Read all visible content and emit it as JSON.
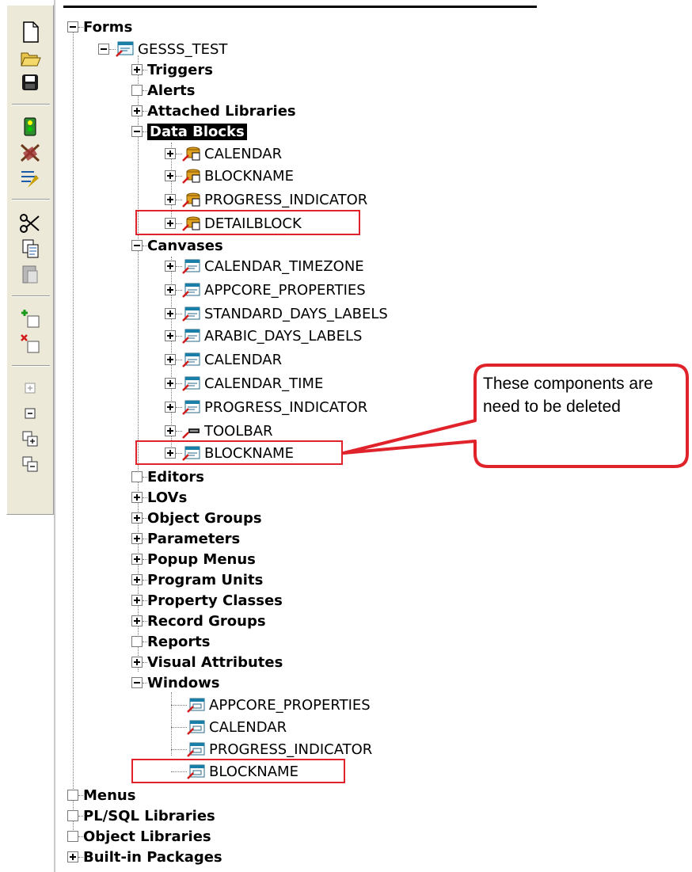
{
  "toolbar": {
    "buttons": [
      {
        "name": "new-icon"
      },
      {
        "name": "open-icon"
      },
      {
        "name": "save-icon"
      },
      {
        "name": "run-icon"
      },
      {
        "name": "debug-icon"
      },
      {
        "name": "compile-icon"
      },
      {
        "name": "cut-icon"
      },
      {
        "name": "copy-icon"
      },
      {
        "name": "paste-icon"
      },
      {
        "name": "create-icon"
      },
      {
        "name": "delete-icon"
      },
      {
        "name": "expand-icon"
      },
      {
        "name": "collapse-icon"
      },
      {
        "name": "expand-all-icon"
      },
      {
        "name": "collapse-all-icon"
      }
    ]
  },
  "tree": {
    "forms": "Forms",
    "module": "GESSS_TEST",
    "triggers": "Triggers",
    "alerts": "Alerts",
    "attached_libraries": "Attached Libraries",
    "data_blocks": "Data Blocks",
    "blocks": [
      "CALENDAR",
      "BLOCKNAME",
      "PROGRESS_INDICATOR",
      "DETAILBLOCK"
    ],
    "canvases": "Canvases",
    "canvas_items": [
      "CALENDAR_TIMEZONE",
      "APPCORE_PROPERTIES",
      "STANDARD_DAYS_LABELS",
      "ARABIC_DAYS_LABELS",
      "CALENDAR",
      "CALENDAR_TIME",
      "PROGRESS_INDICATOR",
      "TOOLBAR",
      "BLOCKNAME"
    ],
    "editors": "Editors",
    "lovs": "LOVs",
    "object_groups": "Object Groups",
    "parameters": "Parameters",
    "popup_menus": "Popup Menus",
    "program_units": "Program Units",
    "property_classes": "Property Classes",
    "record_groups": "Record Groups",
    "reports": "Reports",
    "visual_attributes": "Visual Attributes",
    "windows": "Windows",
    "window_items": [
      "APPCORE_PROPERTIES",
      "CALENDAR",
      "PROGRESS_INDICATOR",
      "BLOCKNAME"
    ],
    "menus": "Menus",
    "plsql_libraries": "PL/SQL Libraries",
    "object_libraries": "Object Libraries",
    "builtin_packages": "Built-in Packages"
  },
  "callout": {
    "text": "These components are need to be deleted"
  },
  "colors": {
    "highlight": "#e0232b",
    "selection_bg": "#000000"
  }
}
